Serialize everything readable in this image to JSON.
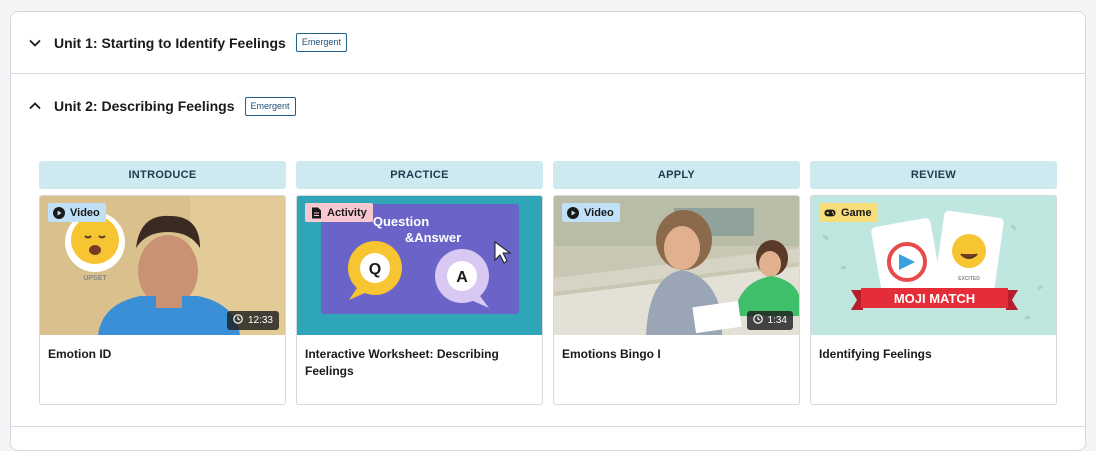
{
  "units": [
    {
      "number": "Unit 1:",
      "name": "Starting to Identify Feelings",
      "badge": "Emergent",
      "expanded": false
    },
    {
      "number": "Unit 2:",
      "name": "Describing Feelings",
      "badge": "Emergent",
      "expanded": true
    }
  ],
  "cards": [
    {
      "phase": "INTRODUCE",
      "type": "Video",
      "type_icon": "play-icon",
      "title": "Emotion ID",
      "duration": "12:33",
      "thumb_text": "UPSET"
    },
    {
      "phase": "PRACTICE",
      "type": "Activity",
      "type_icon": "document-icon",
      "title": "Interactive Worksheet: Describing Feelings",
      "thumb_heading_1": "Question",
      "thumb_heading_2": "&Answer",
      "bubble_q": "Q",
      "bubble_a": "A"
    },
    {
      "phase": "APPLY",
      "type": "Video",
      "type_icon": "play-icon",
      "title": "Emotions Bingo I",
      "duration": "1:34"
    },
    {
      "phase": "REVIEW",
      "type": "Game",
      "type_icon": "gamepad-icon",
      "title": "Identifying Feelings",
      "thumb_banner": "MOJI MATCH",
      "thumb_card_label": "EXCITED"
    }
  ],
  "colors": {
    "phase_bg": "#cfe9f1",
    "video_tag": "#bfe0f7",
    "activity_tag": "#f7c7d2",
    "game_tag": "#f7dc7a",
    "badge_border": "#1f5f8b"
  }
}
